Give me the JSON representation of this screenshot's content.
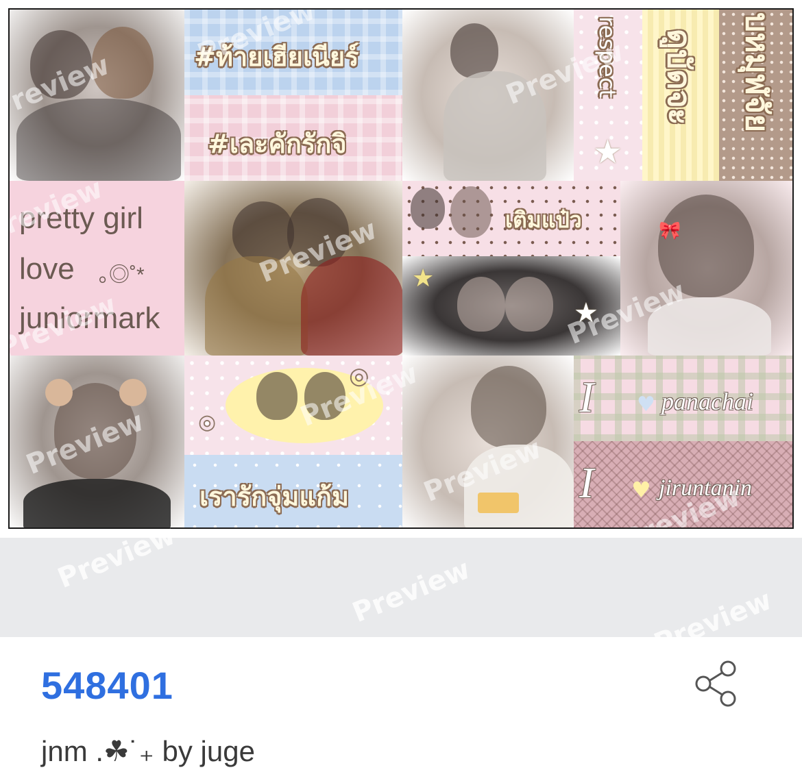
{
  "preview": {
    "watermark": "Preview",
    "stickers": {
      "hashtag_1": "#ท้ายเฮียเนียร์",
      "hashtag_2": "#เละคักรักจิ",
      "respect": "respect",
      "vertical_1": "ดูบัดจะ",
      "vertical_2": "บหมุฬจัย",
      "pretty_girl": "pretty girl",
      "love": "love",
      "love_swirl": "｡◎˚*",
      "juniormark": "juniormark",
      "toem_paew": "เติมแป๋ว",
      "rao_rak": "เรารักจุ่มแก้ม",
      "i_letter_1": "I",
      "panachai": "panachai",
      "i_letter_2": "I",
      "jiruntanin": "jiruntanin",
      "heart": "♥",
      "swirl": "◎",
      "star": "★"
    }
  },
  "item": {
    "code": "548401",
    "caption": "jnm  .☘˙₊ by juge",
    "share_icon": "share-icon"
  },
  "colors": {
    "code_blue": "#2f6fe0",
    "footer_gray": "#e9eaec",
    "sticker_outline": "#8a6a52"
  }
}
